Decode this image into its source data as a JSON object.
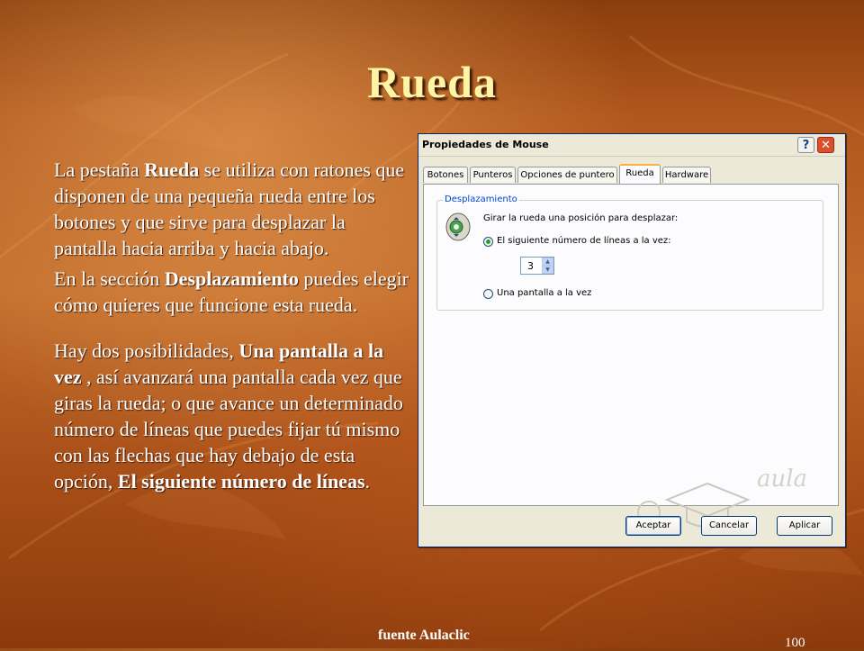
{
  "slide": {
    "title": "Rueda",
    "paragraphs": {
      "p1": {
        "a": "La pestaña ",
        "b": "Rueda",
        "c": " se utiliza con ratones que disponen de una pequeña rueda entre los botones y que sirve para desplazar la pantalla hacia arriba y hacia abajo."
      },
      "p2": {
        "a": "En la sección ",
        "b": "Desplazamiento",
        "c": " puedes elegir cómo quieres que funcione esta rueda."
      },
      "p3": {
        "a": "Hay dos posibilidades, ",
        "b": "Una pantalla a la vez",
        "c": " , así avanzará una pantalla cada vez que giras la rueda; o que avance un determinado número de líneas que puedes fijar tú mismo con las flechas que hay debajo de esta opción, ",
        "d": "El siguiente número de líneas",
        "e": "."
      }
    },
    "footer_source": "fuente Aulaclic",
    "page_number": "100"
  },
  "dialog": {
    "title": "Propiedades de Mouse",
    "help_label": "?",
    "close_label": "✕",
    "tabs": [
      "Botones",
      "Punteros",
      "Opciones de puntero",
      "Rueda",
      "Hardware"
    ],
    "active_tab": "Rueda",
    "group_label": "Desplazamiento",
    "instruction": "Girar la rueda una posición para desplazar:",
    "option_lines": "El siguiente número de líneas a la vez:",
    "lines_value": "3",
    "option_screen": "Una pantalla a la vez",
    "selected_option": "lines",
    "buttons": {
      "ok": "Aceptar",
      "cancel": "Cancelar",
      "apply": "Aplicar"
    },
    "watermark": "aula"
  }
}
